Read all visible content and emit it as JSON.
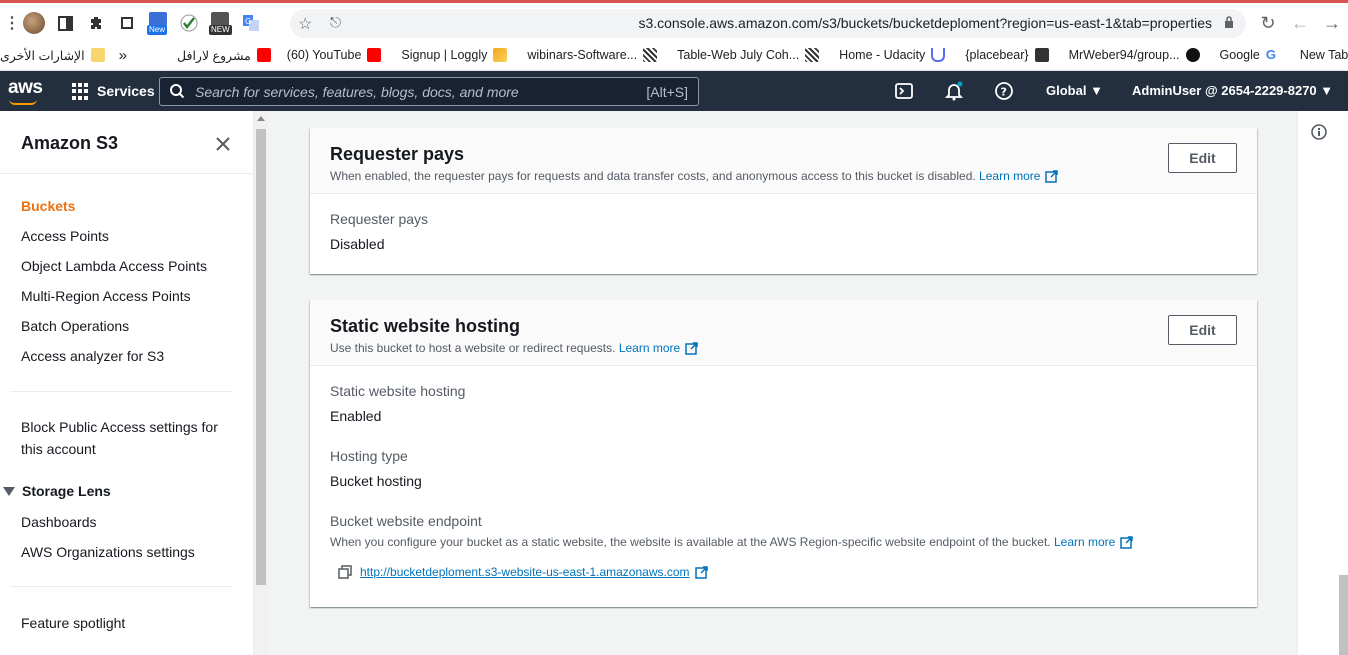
{
  "browser": {
    "url": "s3.console.aws.amazon.com/s3/buckets/bucketdeploment?region=us-east-1&tab=properties",
    "extensions": [
      "profile-avatar",
      "reading-list-icon",
      "puzzle-icon",
      "crop-icon",
      "new-badge-extension",
      "check-extension",
      "new-badge-extension-2",
      "translate-icon"
    ],
    "new_label": "New",
    "new_label_2": "NEW"
  },
  "bookmarks": [
    {
      "label": "الإشارات الأخرى",
      "icon": "folder-icon"
    },
    {
      "label": "»",
      "icon": ""
    },
    {
      "label": "مشروع لارافل",
      "icon": "youtube-icon"
    },
    {
      "label": "(60) YouTube",
      "icon": "youtube-icon"
    },
    {
      "label": "Signup | Loggly",
      "icon": "loggly-icon"
    },
    {
      "label": "wibinars-Software...",
      "icon": "qr-icon"
    },
    {
      "label": "Table-Web July Coh...",
      "icon": "qr-icon"
    },
    {
      "label": "Home - Udacity",
      "icon": "udacity-icon"
    },
    {
      "label": "{placebear}",
      "icon": "bear-icon"
    },
    {
      "label": "MrWeber94/group...",
      "icon": "github-icon"
    },
    {
      "label": "Google",
      "icon": "google-icon"
    },
    {
      "label": "New Tab",
      "icon": "globe-icon"
    }
  ],
  "aws": {
    "logo": "aws",
    "services": "Services",
    "search_placeholder": "Search for services, features, blogs, docs, and more",
    "search_shortcut": "[Alt+S]",
    "region": "Global",
    "account": "AdminUser @ 2654-2229-8270"
  },
  "sidebar": {
    "title": "Amazon S3",
    "items": [
      "Buckets",
      "Access Points",
      "Object Lambda Access Points",
      "Multi-Region Access Points",
      "Batch Operations",
      "Access analyzer for S3"
    ],
    "block_public_access_line1": "Block Public Access settings for",
    "block_public_access_line2": "this account",
    "storage_lens": "Storage Lens",
    "storage_lens_items": [
      "Dashboards",
      "AWS Organizations settings"
    ],
    "feature_spotlight": "Feature spotlight"
  },
  "requester_pays": {
    "title": "Requester pays",
    "description": "When enabled, the requester pays for requests and data transfer costs, and anonymous access to this bucket is disabled.",
    "learn_more": "Learn more",
    "edit": "Edit",
    "field_label": "Requester pays",
    "field_value": "Disabled"
  },
  "static_hosting": {
    "title": "Static website hosting",
    "description": "Use this bucket to host a website or redirect requests.",
    "learn_more": "Learn more",
    "edit": "Edit",
    "hosting_label": "Static website hosting",
    "hosting_value": "Enabled",
    "type_label": "Hosting type",
    "type_value": "Bucket hosting",
    "endpoint_label": "Bucket website endpoint",
    "endpoint_desc": "When you configure your bucket as a static website, the website is available at the AWS Region-specific website endpoint of the bucket.",
    "endpoint_learn_more": "Learn more",
    "endpoint_url": "http://bucketdeploment.s3-website-us-east-1.amazonaws.com"
  },
  "colors": {
    "aws_header": "#232f3e",
    "accent_orange": "#ec7211",
    "link_blue": "#0073bb"
  }
}
